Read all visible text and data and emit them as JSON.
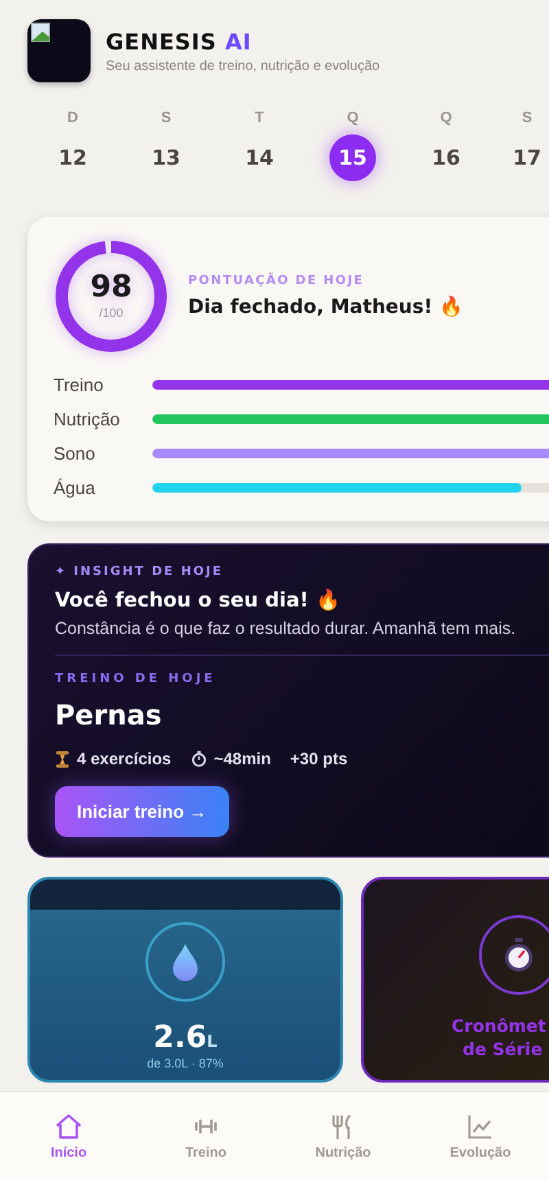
{
  "header": {
    "brand": "GENESIS",
    "brand_accent": "AI",
    "subtitle": "Seu assistente de treino, nutrição e evolução"
  },
  "days": [
    {
      "weekday": "D",
      "day": "12",
      "selected": false
    },
    {
      "weekday": "S",
      "day": "13",
      "selected": false
    },
    {
      "weekday": "T",
      "day": "14",
      "selected": false
    },
    {
      "weekday": "Q",
      "day": "15",
      "selected": true
    },
    {
      "weekday": "Q",
      "day": "16",
      "selected": false
    },
    {
      "weekday": "S",
      "day": "17",
      "selected": false
    }
  ],
  "score": {
    "value": "98",
    "max": "/100",
    "label": "PONTUAÇÃO DE HOJE",
    "headline": "Dia fechado, Matheus! 🔥",
    "bars": [
      {
        "name": "Treino",
        "level": 1,
        "color": "#9333ea"
      },
      {
        "name": "Nutrição",
        "level": 1,
        "color": "#22c55e"
      },
      {
        "name": "Sono",
        "level": 1,
        "color": "#a78bfa"
      },
      {
        "name": "Água",
        "level": 0.87,
        "color": "#22d3ee"
      }
    ]
  },
  "insight": {
    "label": "✦ INSIGHT DE HOJE",
    "title": "Você fechou o seu dia! 🔥",
    "text": "Constância é o que faz o resultado durar. Amanhã tem mais."
  },
  "workout": {
    "label": "TREINO DE HOJE",
    "name": "Pernas",
    "meta": [
      {
        "kind": "exercises",
        "text": "4 exercícios"
      },
      {
        "kind": "time",
        "text": "~48min"
      },
      {
        "kind": "points",
        "text": "+30 pts"
      }
    ],
    "button": "Iniciar treino →"
  },
  "water": {
    "value": "2.6",
    "unit": "L",
    "detail": "de 3.0L · 87%"
  },
  "timer": {
    "title_lines": [
      "Cronômet",
      "de Série"
    ]
  },
  "nav": [
    {
      "kind": "home",
      "label": "Início",
      "selected": true
    },
    {
      "kind": "workout",
      "label": "Treino",
      "selected": false
    },
    {
      "kind": "nutrition",
      "label": "Nutrição",
      "selected": false
    },
    {
      "kind": "progress",
      "label": "Evolução",
      "selected": false
    }
  ]
}
